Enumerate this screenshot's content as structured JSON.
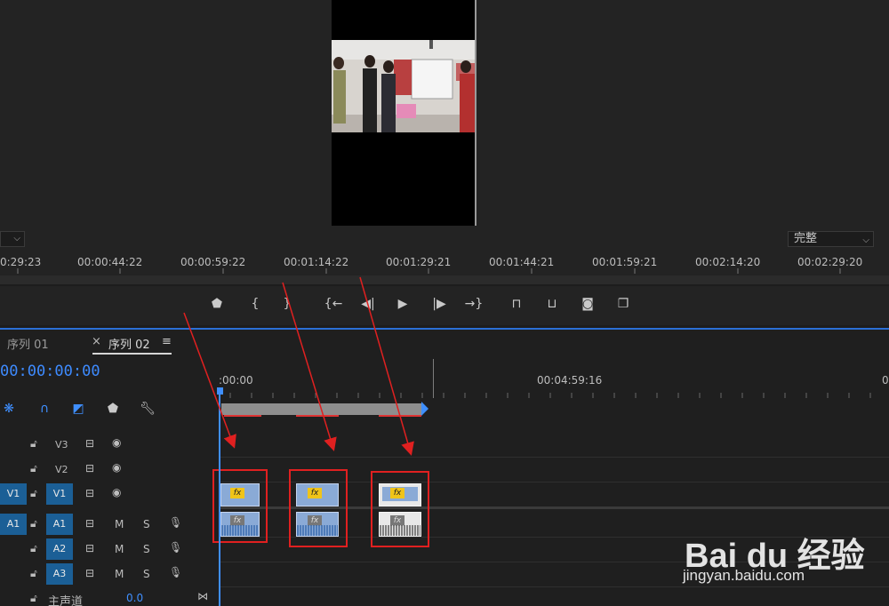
{
  "monitor": {
    "quality_value": "完整",
    "ruler_timecodes": [
      "0:29:23",
      "00:00:44:22",
      "00:00:59:22",
      "00:01:14:22",
      "00:01:29:21",
      "00:01:44:21",
      "00:01:59:21",
      "00:02:14:20",
      "00:02:29:20"
    ]
  },
  "transport": {
    "buttons": [
      "add-marker",
      "mark-in",
      "mark-out",
      "go-to-in",
      "step-back",
      "play",
      "step-forward",
      "go-to-out",
      "lift",
      "extract",
      "export-frame",
      "comparison-view"
    ]
  },
  "timeline": {
    "tabs": [
      {
        "label": "序列 01",
        "active": false
      },
      {
        "label": "序列 02",
        "active": true
      }
    ],
    "close_glyph": "×",
    "menu_glyph": "≡",
    "timecode": "00:00:00:00",
    "ruler_labels": [
      ":00:00",
      "00:04:59:16",
      "0"
    ],
    "tracks": [
      {
        "target": "",
        "name": "V3",
        "kind": "video"
      },
      {
        "target": "",
        "name": "V2",
        "kind": "video"
      },
      {
        "target": "V1",
        "name": "V1",
        "kind": "video"
      },
      {
        "target": "A1",
        "name": "A1",
        "kind": "audio"
      },
      {
        "target": "",
        "name": "A2",
        "kind": "audio"
      },
      {
        "target": "",
        "name": "A3",
        "kind": "audio"
      }
    ],
    "mute_label": "M",
    "solo_label": "S",
    "master_label": "主声道",
    "master_value": "0.0",
    "fx_label": "fx"
  },
  "watermark": {
    "brand": "Bai du 经验",
    "url": "jingyan.baidu.com"
  },
  "colors": {
    "accent_blue": "#3f8fff",
    "clip_blue": "#8aaad6",
    "annotation_red": "#e02020",
    "track_target": "#1b5f96"
  }
}
